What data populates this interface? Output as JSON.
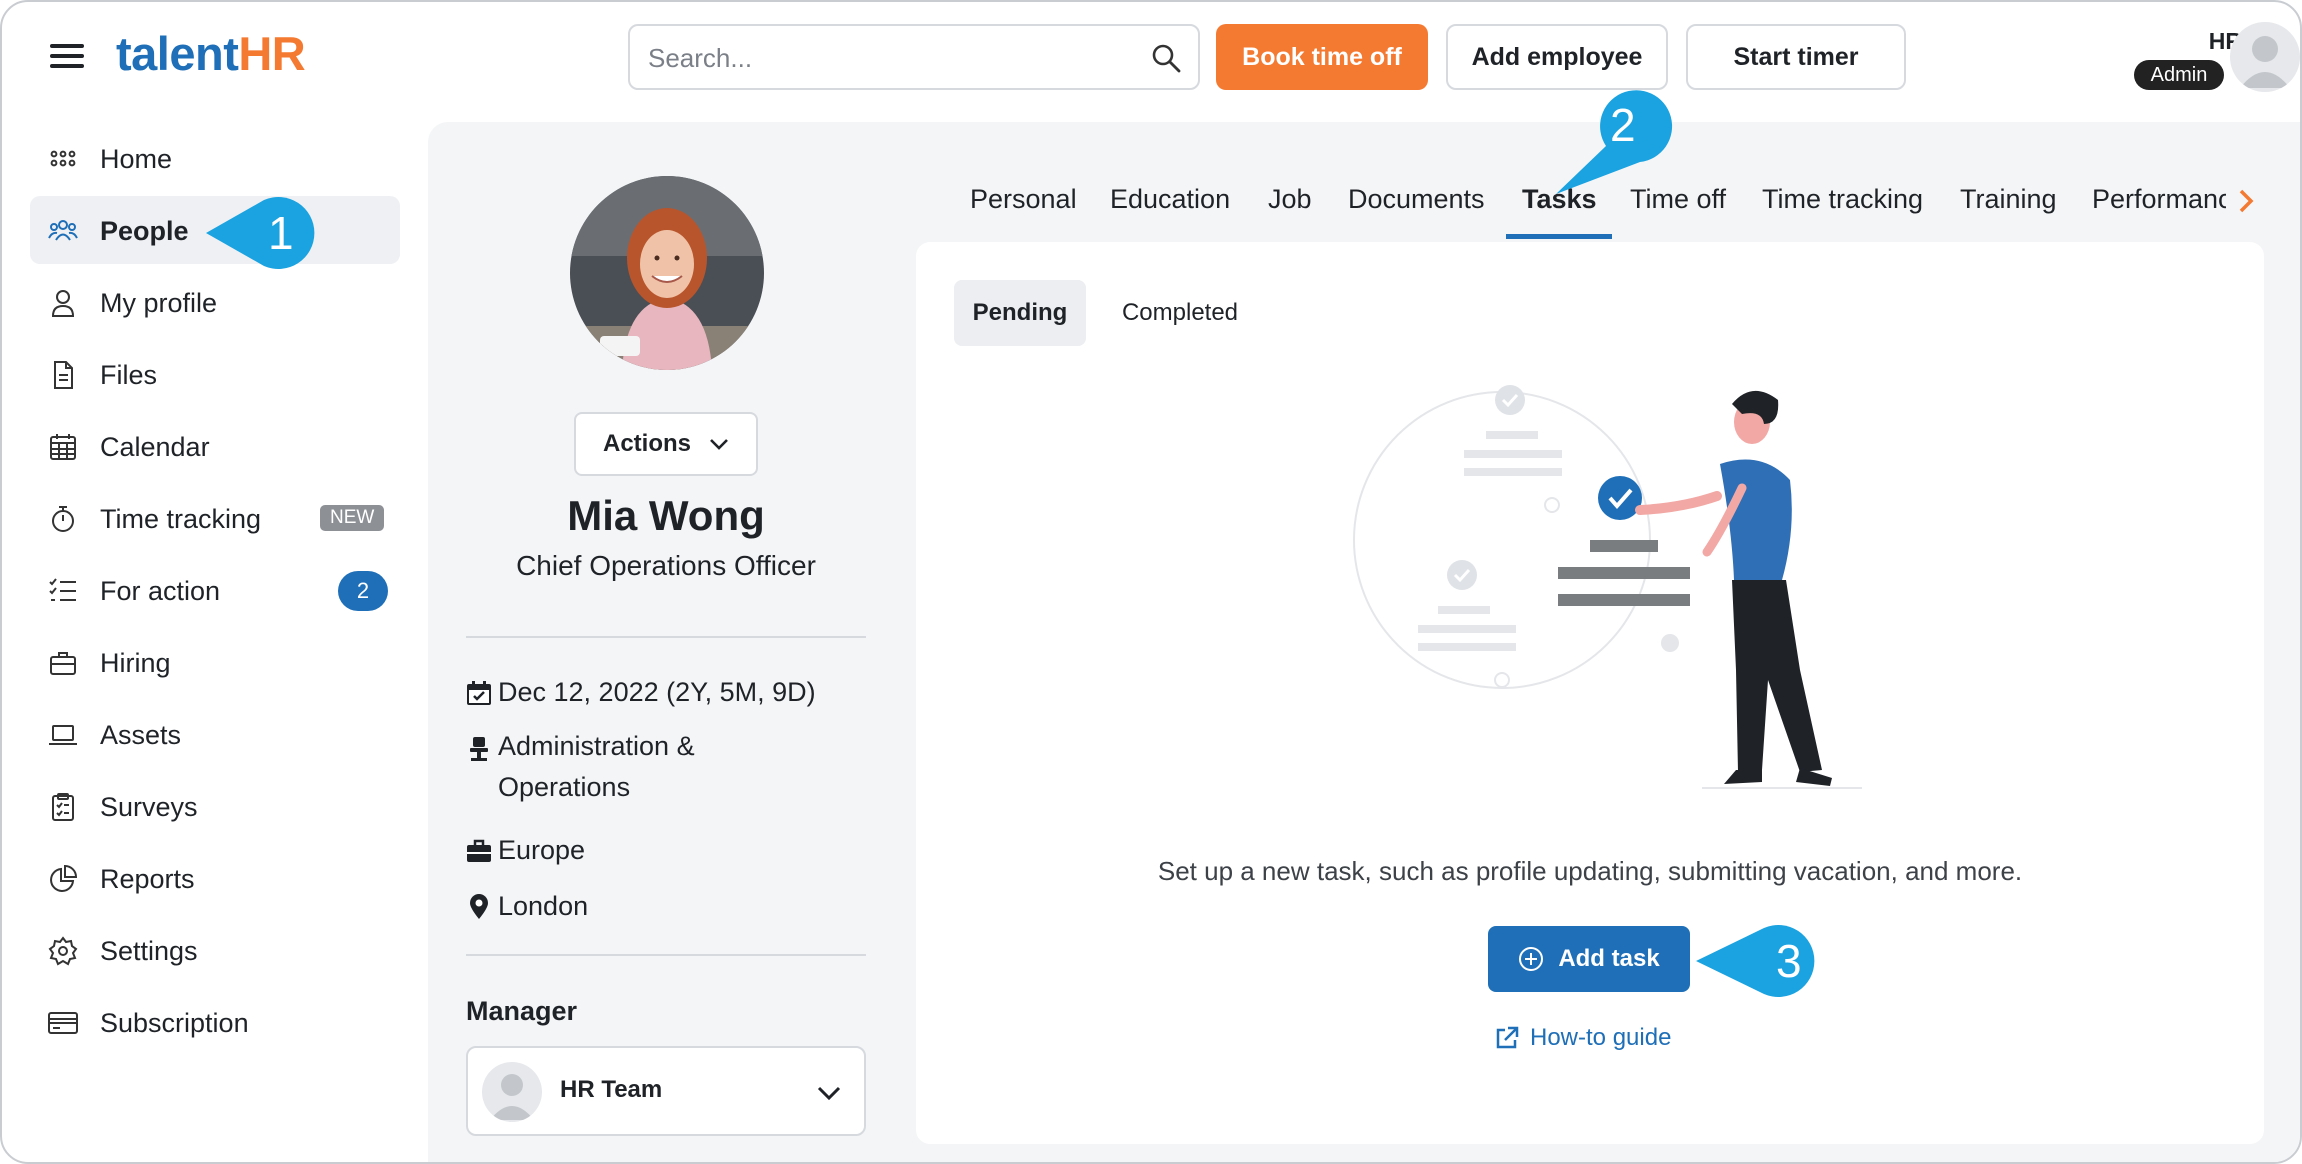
{
  "header": {
    "logo_part1": "talent",
    "logo_part2": "HR",
    "search_placeholder": "Search...",
    "book_time_off_label": "Book time off",
    "add_employee_label": "Add employee",
    "start_timer_label": "Start timer",
    "user_initials": "HR",
    "user_role": "Admin"
  },
  "sidebar": {
    "items": [
      {
        "label": "Home",
        "icon": "home-grid-icon"
      },
      {
        "label": "People",
        "icon": "people-icon",
        "active": true
      },
      {
        "label": "My profile",
        "icon": "person-icon"
      },
      {
        "label": "Files",
        "icon": "file-icon"
      },
      {
        "label": "Calendar",
        "icon": "calendar-icon"
      },
      {
        "label": "Time tracking",
        "icon": "stopwatch-icon",
        "badge": "NEW"
      },
      {
        "label": "For action",
        "icon": "checklist-icon",
        "count": "2"
      },
      {
        "label": "Hiring",
        "icon": "briefcase-icon"
      },
      {
        "label": "Assets",
        "icon": "laptop-icon"
      },
      {
        "label": "Surveys",
        "icon": "clipboard-icon"
      },
      {
        "label": "Reports",
        "icon": "pie-chart-icon"
      },
      {
        "label": "Settings",
        "icon": "gear-icon"
      },
      {
        "label": "Subscription",
        "icon": "card-icon"
      }
    ]
  },
  "profile": {
    "actions_label": "Actions",
    "name": "Mia Wong",
    "title": "Chief Operations Officer",
    "start_date": "Dec 12, 2022 (2Y, 5M, 9D)",
    "department_line1": "Administration &",
    "department_line2": "Operations",
    "division": "Europe",
    "location": "London",
    "manager_label": "Manager",
    "manager_name": "HR Team"
  },
  "tabs": [
    "Personal",
    "Education",
    "Job",
    "Documents",
    "Tasks",
    "Time off",
    "Time tracking",
    "Training",
    "Performance"
  ],
  "active_tab": "Tasks",
  "tasks": {
    "subtabs": [
      "Pending",
      "Completed"
    ],
    "active_subtab": "Pending",
    "empty_message": "Set up a new task, such as profile updating, submitting vacation, and more.",
    "add_task_label": "Add task",
    "howto_label": "How-to guide"
  },
  "callouts": [
    "1",
    "2",
    "3"
  ],
  "colors": {
    "brand_blue": "#1e6fb8",
    "brand_orange": "#f47a32",
    "callout_blue": "#1aa3e0"
  }
}
